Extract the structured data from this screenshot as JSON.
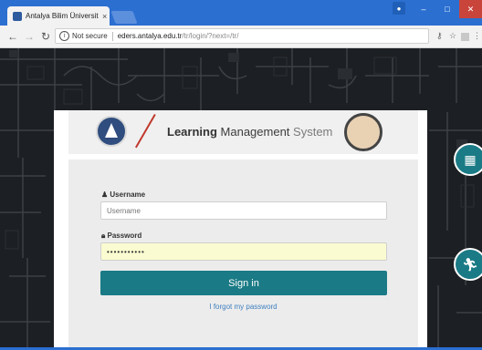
{
  "browser": {
    "tab_title": "Antalya Bilim Üniversitesi",
    "tab_close": "×",
    "security_label": "Not secure",
    "url_host": "eders.antalya.edu.tr",
    "url_path": "/tr/login/?next=/tr/"
  },
  "banner": {
    "title_bold": "Learning",
    "title_mid": "Management",
    "title_light": "System"
  },
  "login": {
    "username_label": "Username",
    "username_placeholder": "Username",
    "password_label": "Password",
    "password_value": "•••••••••••",
    "signin_label": "Sign in",
    "forgot_label": "I forgot my password"
  },
  "colors": {
    "accent": "#1a7b86",
    "titlebar": "#2b6fd0",
    "close": "#c9443b"
  },
  "icons": [
    "back-arrow-icon",
    "forward-arrow-icon",
    "reload-icon",
    "info-icon",
    "key-icon",
    "star-icon",
    "extension-icon",
    "menu-icon",
    "calendar-icon",
    "running-person-icon",
    "user-icon",
    "lock-icon"
  ]
}
